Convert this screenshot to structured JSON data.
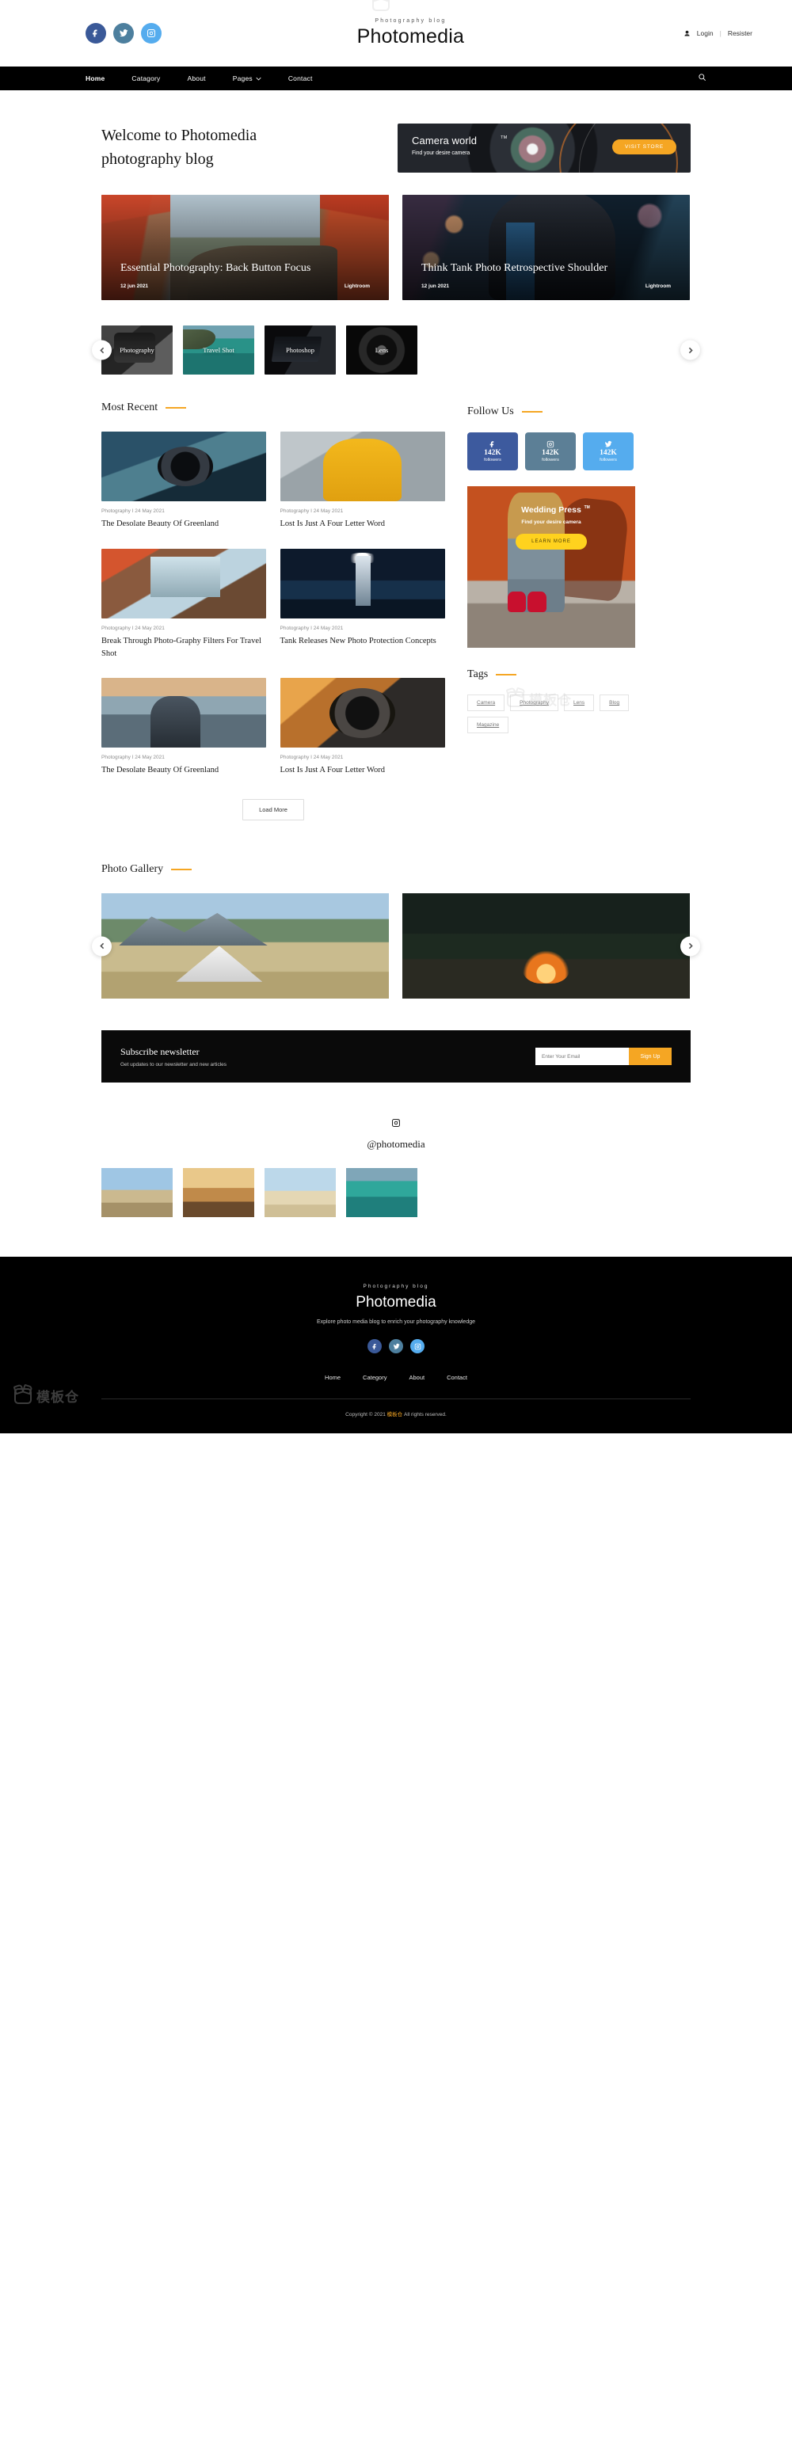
{
  "header": {
    "social": [
      {
        "name": "facebook",
        "glyph": "f"
      },
      {
        "name": "twitter",
        "glyph": "t"
      },
      {
        "name": "instagram",
        "glyph": "i"
      }
    ],
    "brand_sub": "Photography blog",
    "brand_title": "Photomedia",
    "login": "Login",
    "separator": "|",
    "register": "Resister"
  },
  "nav": {
    "items": [
      {
        "label": "Home",
        "active": true,
        "dropdown": false
      },
      {
        "label": "Catagory",
        "active": false,
        "dropdown": false
      },
      {
        "label": "About",
        "active": false,
        "dropdown": false
      },
      {
        "label": "Pages",
        "active": false,
        "dropdown": true
      },
      {
        "label": "Contact",
        "active": false,
        "dropdown": false
      }
    ],
    "search_icon": "search-icon"
  },
  "hero": {
    "title_line1": "Welcome to Photomedia",
    "title_line2": "photography blog",
    "ad": {
      "heading": "Camera world",
      "tm": "TM",
      "subtitle": "Find your desire camera",
      "button": "VISIT STORE"
    }
  },
  "features": [
    {
      "title": "Essential Photography: Back Button Focus",
      "date": "12 jun 2021",
      "category": "Lightroom"
    },
    {
      "title": "Think Tank Photo Retrospective Shoulder",
      "date": "12 jun 2021",
      "category": "Lightroom"
    }
  ],
  "categories": [
    {
      "label": "Photography"
    },
    {
      "label": "Travel Shot"
    },
    {
      "label": "Photoshop"
    },
    {
      "label": "Lens"
    }
  ],
  "most_recent": {
    "heading": "Most Recent",
    "posts": [
      {
        "meta": "Photography I 24 May 2021",
        "title": "The Desolate Beauty Of Greenland"
      },
      {
        "meta": "Photography I 24 May 2021",
        "title": "Lost Is Just A Four Letter Word"
      },
      {
        "meta": "Photography I 24 May 2021",
        "title": "Break Through Photo-Graphy Filters For Travel Shot"
      },
      {
        "meta": "Photography I 24 May 2021",
        "title": "Tank Releases New Photo Protection Concepts"
      },
      {
        "meta": "Photography I 24 May 2021",
        "title": "The Desolate Beauty Of Greenland"
      },
      {
        "meta": "Photography I 24 May 2021",
        "title": "Lost Is Just A Four Letter Word"
      }
    ],
    "load_more": "Load More"
  },
  "sidebar": {
    "follow_heading": "Follow Us",
    "follow_boxes": [
      {
        "network": "facebook",
        "count": "142K",
        "label": "followers",
        "color": "#3d5a9e"
      },
      {
        "network": "instagram",
        "count": "142K",
        "label": "followers",
        "color": "#5c7f96"
      },
      {
        "network": "twitter",
        "count": "142K",
        "label": "followers",
        "color": "#55acee"
      }
    ],
    "ad": {
      "heading": "Wedding Press",
      "tm": "TM",
      "subtitle": "Find your desire camera",
      "button": "LEARN MORE"
    },
    "tags_heading": "Tags",
    "tags": [
      "Camera",
      "Photography",
      "Lens",
      "Blog",
      "Magazine"
    ]
  },
  "gallery": {
    "heading": "Photo Gallery"
  },
  "newsletter": {
    "heading": "Subscribe newsletter",
    "subtitle": "Get updates to our newsletter and new articles",
    "placeholder": "Enter Your Email",
    "button": "Sign Up"
  },
  "instagram": {
    "handle": "@photomedia"
  },
  "footer": {
    "sub": "Photography blog",
    "title": "Photomedia",
    "desc": "Explore photo media blog to enrich your photography knowledge",
    "nav": [
      "Home",
      "Category",
      "About",
      "Contact"
    ],
    "copyright_pre": "Copyright © 2021",
    "copyright_brand": "模板仓",
    "copyright_post": "All rights reserved."
  },
  "watermark": {
    "text": "模板仓"
  },
  "colors": {
    "accent": "#f5a623",
    "nav_bg": "#000000",
    "facebook": "#3a5998",
    "twitter": "#4d7f9e",
    "instagram": "#55acee"
  }
}
